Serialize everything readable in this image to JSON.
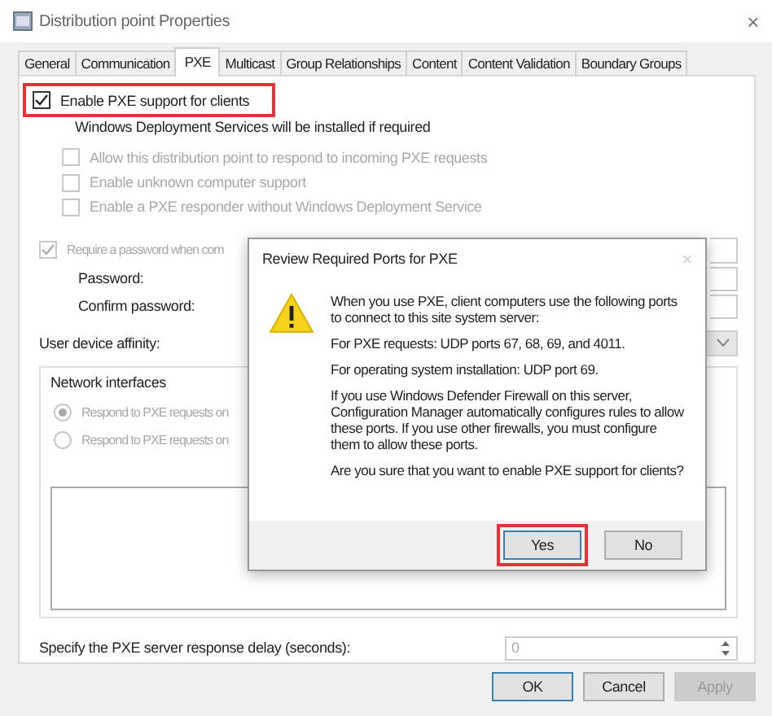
{
  "window": {
    "title": "Distribution point Properties",
    "close": "×"
  },
  "tabs": [
    {
      "label": "General",
      "selected": false
    },
    {
      "label": "Communication",
      "selected": false
    },
    {
      "label": "PXE",
      "selected": true
    },
    {
      "label": "Multicast",
      "selected": false
    },
    {
      "label": "Group Relationships",
      "selected": false
    },
    {
      "label": "Content",
      "selected": false
    },
    {
      "label": "Content Validation",
      "selected": false
    },
    {
      "label": "Boundary Groups",
      "selected": false
    }
  ],
  "pxe": {
    "enable": {
      "label": "Enable PXE support for clients",
      "checked": true,
      "highlighted": true
    },
    "note": "Windows Deployment Services will be installed if required",
    "options": [
      {
        "label": "Allow this distribution point to respond to incoming PXE requests",
        "checked": false,
        "disabled": true
      },
      {
        "label": "Enable unknown computer support",
        "checked": false,
        "disabled": true
      },
      {
        "label": "Enable a PXE responder without Windows Deployment Service",
        "checked": false,
        "disabled": true
      }
    ],
    "password_required": {
      "label": "Require a password when com",
      "checked": true,
      "disabled": true
    },
    "password_label": "Password:",
    "confirm_label": "Confirm password:",
    "affinity_label": "User device affinity:",
    "network": {
      "title": "Network interfaces",
      "radios": [
        {
          "label": "Respond to PXE requests on",
          "selected": true,
          "disabled": true
        },
        {
          "label": "Respond to PXE requests on",
          "selected": false,
          "disabled": true
        }
      ]
    },
    "delay": {
      "label": "Specify the PXE server response delay (seconds):",
      "value": "0"
    }
  },
  "buttons": [
    {
      "label": "OK",
      "default": true,
      "disabled": false
    },
    {
      "label": "Cancel",
      "default": false,
      "disabled": false
    },
    {
      "label": "Apply",
      "default": false,
      "disabled": true
    }
  ],
  "dialog": {
    "title": "Review Required Ports for PXE",
    "close": "×",
    "paragraphs": [
      "When you use PXE, client computers use the following ports to connect to this site system server:",
      "For PXE requests: UDP ports 67, 68, 69, and 4011.",
      "For operating system installation: UDP port 69.",
      "If you use Windows Defender Firewall on this server, Configuration Manager automatically configures rules to allow these ports. If you use other firewalls, you must configure them to allow these ports.",
      "Are you sure that you want to enable PXE support for clients?"
    ],
    "buttons": [
      {
        "label": "Yes",
        "default": true,
        "highlighted": true
      },
      {
        "label": "No",
        "default": false,
        "highlighted": false
      }
    ]
  }
}
